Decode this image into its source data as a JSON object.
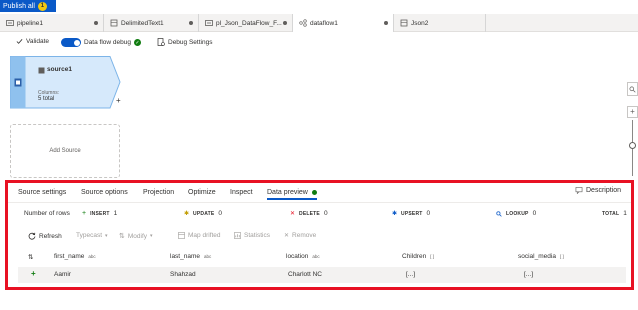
{
  "publish": {
    "label": "Publish all",
    "badge": "1"
  },
  "tabs": [
    {
      "label": "pipeline1"
    },
    {
      "label": "DelimitedText1"
    },
    {
      "label": "pl_Json_DataFlow_F..."
    },
    {
      "label": "dataflow1"
    },
    {
      "label": "Json2"
    }
  ],
  "toolbar": {
    "validate": "Validate",
    "debug": "Data flow debug",
    "debug_settings": "Debug Settings"
  },
  "canvas": {
    "source": {
      "name": "source1",
      "columns_label": "Columns:",
      "columns_value": "5 total"
    },
    "add_source": "Add Source"
  },
  "panel": {
    "tabs": [
      "Source settings",
      "Source options",
      "Projection",
      "Optimize",
      "Inspect",
      "Data preview"
    ],
    "description": "Description",
    "stats": {
      "rows_label": "Number of rows",
      "insert_key": "INSERT",
      "insert_val": "1",
      "update_key": "UPDATE",
      "update_val": "0",
      "delete_key": "DELETE",
      "delete_val": "0",
      "upsert_key": "UPSERT",
      "upsert_val": "0",
      "lookup_key": "LOOKUP",
      "lookup_val": "0",
      "total_key": "TOTAL",
      "total_val": "1"
    },
    "actions": {
      "refresh": "Refresh",
      "typecast": "Typecast",
      "modify": "Modify",
      "map_drifted": "Map drifted",
      "statistics": "Statistics",
      "remove": "Remove"
    },
    "columns": [
      {
        "name": "first_name",
        "type": "abc"
      },
      {
        "name": "last_name",
        "type": "abc"
      },
      {
        "name": "location",
        "type": "abc"
      },
      {
        "name": "Children",
        "type": "[ ]"
      },
      {
        "name": "social_media",
        "type": "[ ]"
      }
    ],
    "row": {
      "first_name": "Aamir",
      "last_name": "Shahzad",
      "location": "Charlott NC",
      "children": "[...]",
      "social_media": "[...]"
    }
  },
  "colors": {
    "accent": "#0a59c7",
    "highlight_border": "#e81123",
    "success": "#107c10"
  }
}
